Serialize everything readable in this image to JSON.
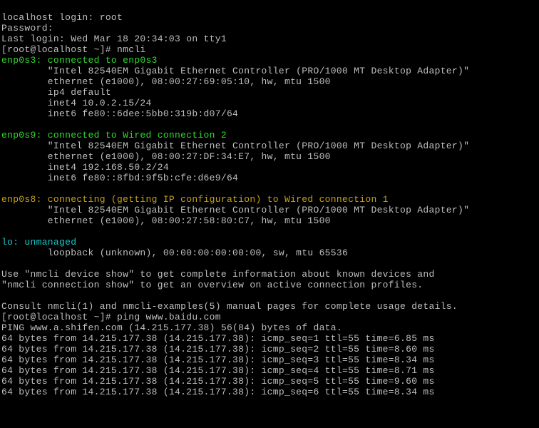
{
  "login": {
    "line1": "localhost login: root",
    "line2": "Password:",
    "line3": "Last login: Wed Mar 18 20:34:03 on tty1",
    "prompt1": "[root@localhost ~]# nmcli"
  },
  "if0": {
    "hdr": "enp0s3: connected to enp0s3",
    "l1": "        \"Intel 82540EM Gigabit Ethernet Controller (PRO/1000 MT Desktop Adapter)\"",
    "l2": "        ethernet (e1000), 08:00:27:69:05:10, hw, mtu 1500",
    "l3": "        ip4 default",
    "l4": "        inet4 10.0.2.15/24",
    "l5": "        inet6 fe80::6dee:5bb0:319b:d07/64"
  },
  "if1": {
    "hdr": "enp0s9: connected to Wired connection 2",
    "l1": "        \"Intel 82540EM Gigabit Ethernet Controller (PRO/1000 MT Desktop Adapter)\"",
    "l2": "        ethernet (e1000), 08:00:27:DF:34:E7, hw, mtu 1500",
    "l3": "        inet4 192.168.50.2/24",
    "l4": "        inet6 fe80::8fbd:9f5b:cfe:d6e9/64"
  },
  "if2": {
    "hdr": "enp0s8: connecting (getting IP configuration) to Wired connection 1",
    "l1": "        \"Intel 82540EM Gigabit Ethernet Controller (PRO/1000 MT Desktop Adapter)\"",
    "l2": "        ethernet (e1000), 08:00:27:58:80:C7, hw, mtu 1500"
  },
  "if3": {
    "hdr": "lo: unmanaged",
    "l1": "        loopback (unknown), 00:00:00:00:00:00, sw, mtu 65536"
  },
  "info": {
    "l1": "Use \"nmcli device show\" to get complete information about known devices and",
    "l2": "\"nmcli connection show\" to get an overview on active connection profiles.",
    "l3": "Consult nmcli(1) and nmcli-examples(5) manual pages for complete usage details."
  },
  "ping": {
    "prompt": "[root@localhost ~]# ping www.baidu.com",
    "hdr": "PING www.a.shifen.com (14.215.177.38) 56(84) bytes of data.",
    "r1": "64 bytes from 14.215.177.38 (14.215.177.38): icmp_seq=1 ttl=55 time=6.85 ms",
    "r2": "64 bytes from 14.215.177.38 (14.215.177.38): icmp_seq=2 ttl=55 time=8.60 ms",
    "r3": "64 bytes from 14.215.177.38 (14.215.177.38): icmp_seq=3 ttl=55 time=8.34 ms",
    "r4": "64 bytes from 14.215.177.38 (14.215.177.38): icmp_seq=4 ttl=55 time=8.71 ms",
    "r5": "64 bytes from 14.215.177.38 (14.215.177.38): icmp_seq=5 ttl=55 time=9.60 ms",
    "r6": "64 bytes from 14.215.177.38 (14.215.177.38): icmp_seq=6 ttl=55 time=8.34 ms"
  }
}
